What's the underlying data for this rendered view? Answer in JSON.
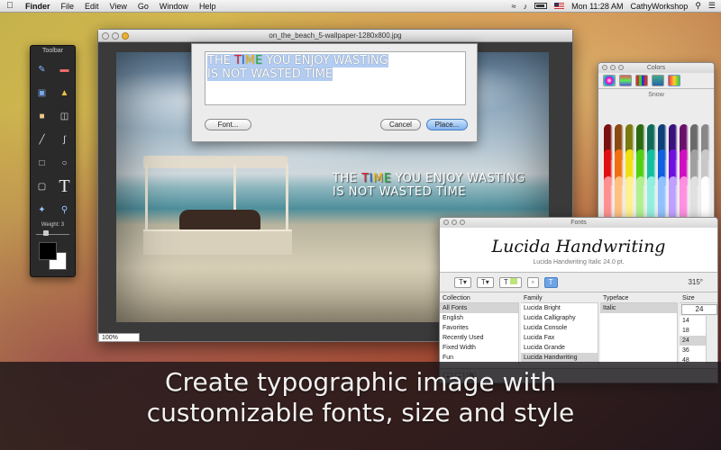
{
  "menubar": {
    "app_name": "Finder",
    "menus": [
      "File",
      "Edit",
      "View",
      "Go",
      "Window",
      "Help"
    ],
    "clock": "Mon 11:28 AM",
    "user": "CathyWorkshop"
  },
  "toolbar": {
    "title": "Toolbar",
    "weight_label": "Weight: 3",
    "tools": [
      "pencil-icon",
      "eraser-icon",
      "layers-icon",
      "bucket-icon",
      "stamp-icon",
      "trash-icon",
      "line-icon",
      "curve-icon",
      "rectangle-icon",
      "ellipse-icon",
      "rounded-rect-icon",
      "text-icon",
      "wand-icon",
      "zoom-icon"
    ],
    "text_tool_glyph": "T"
  },
  "image_window": {
    "title": "on_the_beach_5-wallpaper-1280x800.jpg",
    "zoom": "100%",
    "overlay": {
      "line1_parts": [
        "THE ",
        "T",
        "I",
        "M",
        "E",
        " YOU ENJOY WASTING"
      ],
      "line2": "IS NOT WASTED TIME"
    }
  },
  "text_sheet": {
    "line1_parts": [
      "THE ",
      "T",
      "I",
      "M",
      "E",
      " YOU ENJOY WASTING"
    ],
    "line2": "IS NOT WASTED TIME",
    "font_button": "Font...",
    "cancel_button": "Cancel",
    "place_button": "Place..."
  },
  "colors_window": {
    "title": "Colors",
    "color_name": "Snow"
  },
  "fonts_window": {
    "title": "Fonts",
    "preview_name": "Lucida Handwriting",
    "preview_desc": "Lucida Handwriting Italic 24.0 pt.",
    "angle": "315°",
    "headers": {
      "collection": "Collection",
      "family": "Family",
      "typeface": "Typeface",
      "size": "Size"
    },
    "collections": [
      "All Fonts",
      "English",
      "Favorites",
      "Recently Used",
      "Fixed Width",
      "Fun"
    ],
    "families": [
      "Lucida Bright",
      "Lucida Calligraphy",
      "Lucida Console",
      "Lucida Fax",
      "Lucida Grande",
      "Lucida Handwriting"
    ],
    "typefaces": [
      "Italic"
    ],
    "size_value": "24",
    "sizes": [
      "14",
      "18",
      "24",
      "36",
      "48"
    ]
  },
  "caption": {
    "line1": "Create typographic image with",
    "line2": "customizable fonts, size and style"
  }
}
